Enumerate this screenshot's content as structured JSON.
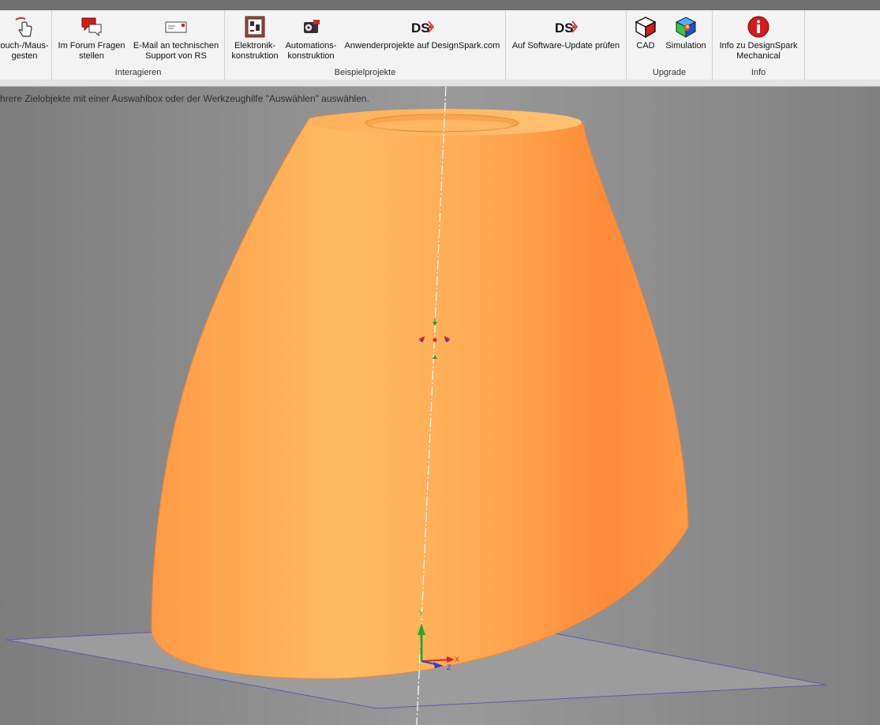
{
  "ribbon": {
    "groups": {
      "interact_label": "Interagieren",
      "examples_label": "Beispielprojekte",
      "upgrade_label": "Upgrade",
      "info_label": "Info"
    },
    "buttons": {
      "touch_line1": "ouch-/Maus-",
      "touch_line2": "gesten",
      "forum_line1": "Im Forum Fragen",
      "forum_line2": "stellen",
      "email_line1": "E-Mail an technischen",
      "email_line2": "Support von RS",
      "elektronik_line1": "Elektronik-",
      "elektronik_line2": "konstruktion",
      "automation_line1": "Automations-",
      "automation_line2": "konstruktion",
      "anwender": "Anwenderprojekte auf DesignSpark.com",
      "update": "Auf Software-Update prüfen",
      "cad": "CAD",
      "simulation": "Simulation",
      "info_line1": "Info zu DesignSpark",
      "info_line2": "Mechanical"
    }
  },
  "status": {
    "hint": "hrere Zielobjekte mit einer Auswahlbox oder der Werkzeughilfe \"Auswählen\" auswählen."
  },
  "axes": {
    "x": "X",
    "y": "Y",
    "z": "Z"
  },
  "colors": {
    "body": "#ff9a45",
    "ribbon_bg": "#f3f3f3",
    "viewport_bg": "#8a8a8a"
  }
}
